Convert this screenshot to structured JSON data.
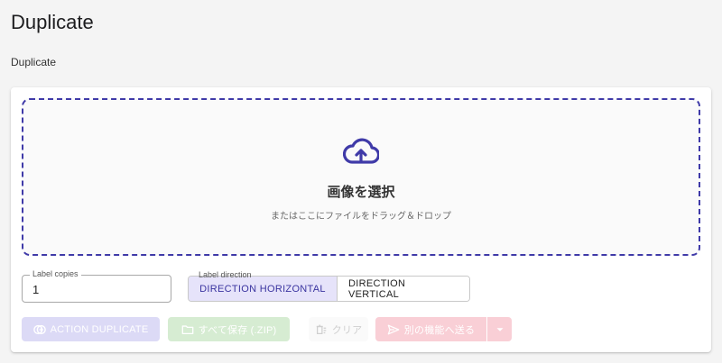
{
  "page": {
    "title": "Duplicate",
    "subtitle": "Duplicate"
  },
  "dropzone": {
    "title": "画像を選択",
    "hint": "またはここにファイルをドラッグ＆ドロップ",
    "icon": "cloud-upload-icon",
    "border_color": "#3f3aa8"
  },
  "copies_field": {
    "label": "Label copies",
    "value": "1"
  },
  "direction": {
    "label": "Label direction",
    "options": [
      "DIRECTION HORIZONTAL",
      "DIRECTION VERTICAL"
    ],
    "selected": "DIRECTION HORIZONTAL"
  },
  "actions": {
    "duplicate_label": "ACTION DUPLICATE",
    "save_zip_label": "すべて保存 (.ZIP)",
    "clear_label": "クリア",
    "send_label": "別の機能へ送る"
  },
  "colors": {
    "accent": "#3f3aa8",
    "duplicate_bg": "#dcdaf6",
    "zip_bg": "#d6ecd2",
    "send_bg": "#f9cfd6"
  }
}
